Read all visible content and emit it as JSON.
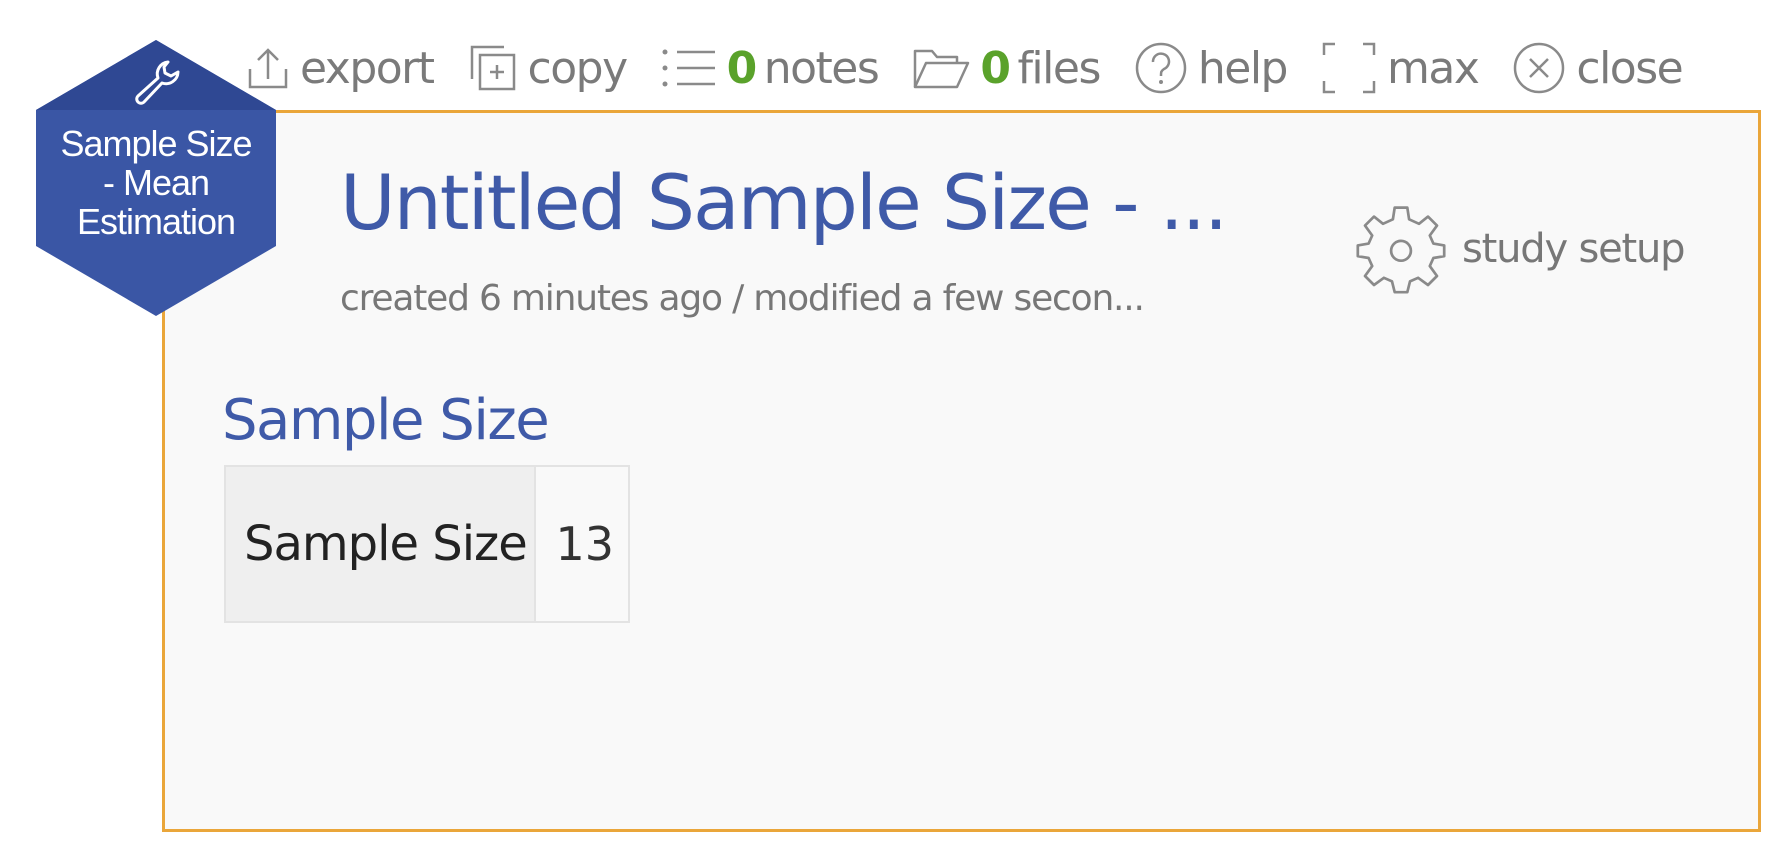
{
  "toolbar": {
    "export_label": "export",
    "copy_label": "copy",
    "notes_count": "0",
    "notes_label": "notes",
    "files_count": "0",
    "files_label": "files",
    "help_label": "help",
    "max_label": "max",
    "close_label": "close"
  },
  "badge": {
    "line1": "Sample Size",
    "line2": "- Mean",
    "line3": "Estimation",
    "icon": "wrench-icon",
    "color": "#3a56a5"
  },
  "study": {
    "title": "Untitled Sample Size - ...",
    "meta": "created 6 minutes ago / modified a few secon...",
    "setup_label": "study setup"
  },
  "results": {
    "section_title": "Sample Size",
    "rows": [
      {
        "label": "Sample Size",
        "value": "13"
      }
    ]
  },
  "colors": {
    "accent": "#3f5aa8",
    "panel_border": "#eaa63a",
    "count_green": "#5aa22b"
  }
}
